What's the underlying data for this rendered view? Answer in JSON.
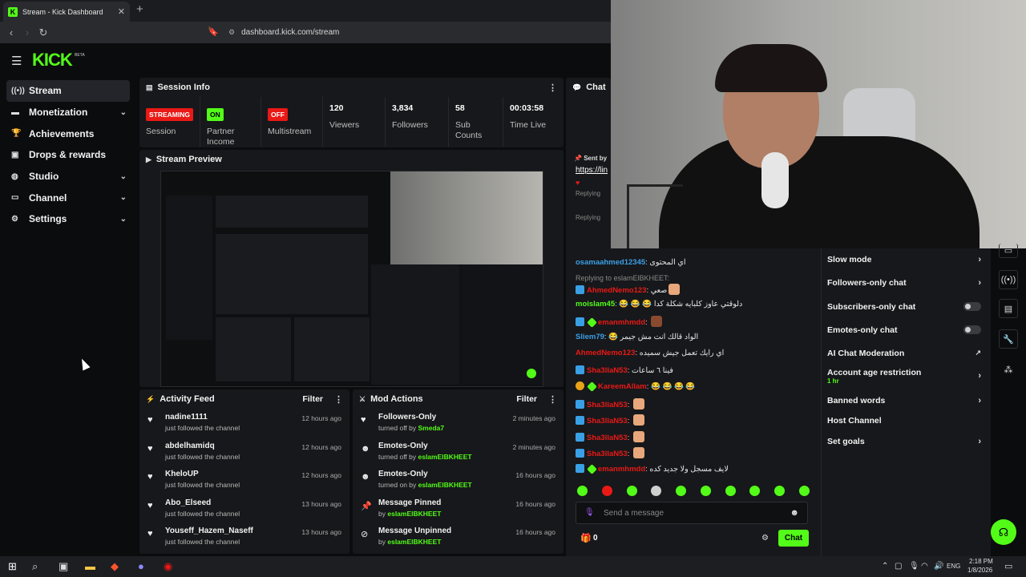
{
  "browser": {
    "tab_title": "Stream - Kick Dashboard",
    "tab_close": "✕",
    "new_tab": "+",
    "url": "dashboard.kick.com/stream"
  },
  "brand": {
    "logo": "KICK",
    "beta": "BETA"
  },
  "sidebar": {
    "items": [
      {
        "label": "Stream",
        "icon": "broadcast-icon"
      },
      {
        "label": "Monetization",
        "icon": "dollar-icon"
      },
      {
        "label": "Achievements",
        "icon": "trophy-icon"
      },
      {
        "label": "Drops & rewards",
        "icon": "gift-icon"
      },
      {
        "label": "Studio",
        "icon": "studio-icon"
      },
      {
        "label": "Channel",
        "icon": "tv-icon"
      },
      {
        "label": "Settings",
        "icon": "gear-icon"
      }
    ]
  },
  "session_info": {
    "title": "Session Info",
    "stats": [
      {
        "badge": "STREAMING",
        "label": "Session"
      },
      {
        "badge": "ON",
        "label": "Partner Income"
      },
      {
        "badge": "OFF",
        "label": "Multistream"
      },
      {
        "value": "120",
        "label": "Viewers"
      },
      {
        "value": "3,834",
        "label": "Followers"
      },
      {
        "value": "58",
        "label": "Sub Counts"
      },
      {
        "value": "00:03:58",
        "label": "Time Live"
      }
    ]
  },
  "stream_preview": {
    "title": "Stream Preview"
  },
  "activity_feed": {
    "title": "Activity Feed",
    "filter": "Filter",
    "items": [
      {
        "name": "nadine1111",
        "sub": "just followed the channel",
        "time": "12 hours ago"
      },
      {
        "name": "abdelhamidq",
        "sub": "just followed the channel",
        "time": "12 hours ago"
      },
      {
        "name": "KheloUP",
        "sub": "just followed the channel",
        "time": "12 hours ago"
      },
      {
        "name": "Abo_Elseed",
        "sub": "just followed the channel",
        "time": "13 hours ago"
      },
      {
        "name": "Youseff_Hazem_Naseff",
        "sub": "just followed the channel",
        "time": "13 hours ago"
      }
    ]
  },
  "mod_actions": {
    "title": "Mod Actions",
    "filter": "Filter",
    "items": [
      {
        "name": "Followers-Only",
        "action": "turned off by",
        "by": "Smeda7",
        "time": "2 minutes ago",
        "icon": "heart-icon"
      },
      {
        "name": "Emotes-Only",
        "action": "turned off by",
        "by": "eslamElBKHEET",
        "time": "2 minutes ago",
        "icon": "smile-icon"
      },
      {
        "name": "Emotes-Only",
        "action": "turned on by",
        "by": "eslamElBKHEET",
        "time": "16 hours ago",
        "icon": "smile-icon"
      },
      {
        "name": "Message Pinned",
        "action": "by",
        "by": "eslamElBKHEET",
        "time": "16 hours ago",
        "icon": "pin-icon"
      },
      {
        "name": "Message Unpinned",
        "action": "by",
        "by": "eslamElBKHEET",
        "time": "16 hours ago",
        "icon": "unpin-icon"
      }
    ]
  },
  "chat": {
    "title": "Chat",
    "sent_by": "Sent by",
    "link_text": "https://lin",
    "replying": "Replying",
    "messages": [
      {
        "user": "osamaahmed12345",
        "color": "#3aa0e6",
        "text": "اي المحتوى"
      },
      {
        "reply": "Replying to eslamElBKHEET:"
      },
      {
        "user": "AhmedNemo123",
        "color": "#e91916",
        "text": "صعي"
      },
      {
        "user": "moislam45",
        "color": "#53fc18",
        "text": "😂 😂 😂 دلوقتي عاوز كلبايه شكلة كدا"
      },
      {
        "user": "emanmhmdd",
        "color": "#e91916",
        "text": ""
      },
      {
        "user": "Sliem79",
        "color": "#3aa0e6",
        "text": "😂 الواد قالك انت مش جيمر"
      },
      {
        "user": "AhmedNemo123",
        "color": "#e91916",
        "text": "اي رايك تعمل جيش سميده"
      },
      {
        "user": "Sha3llaN53",
        "color": "#e91916",
        "text": "فينا ٦ ساعات"
      },
      {
        "user": "KareemAllam",
        "color": "#e91916",
        "text": "😂 😂 😂 😂"
      },
      {
        "user": "Sha3llaN53",
        "color": "#e91916",
        "text": ""
      },
      {
        "user": "Sha3llaN53",
        "color": "#e91916",
        "text": ""
      },
      {
        "user": "Sha3llaN53",
        "color": "#e91916",
        "text": ""
      },
      {
        "user": "Sha3llaN53",
        "color": "#e91916",
        "text": ""
      },
      {
        "user": "emanmhmdd",
        "color": "#e91916",
        "text": "لايف مسجل ولا جديد كده"
      }
    ],
    "input_placeholder": "Send a message",
    "viewer_count": "0",
    "send_label": "Chat"
  },
  "chat_settings": {
    "items": [
      {
        "label": "Slow mode",
        "type": "chevron"
      },
      {
        "label": "Followers-only chat",
        "type": "chevron"
      },
      {
        "label": "Subscribers-only chat",
        "type": "toggle"
      },
      {
        "label": "Emotes-only chat",
        "type": "toggle"
      },
      {
        "label": "AI Chat Moderation",
        "type": "external"
      },
      {
        "label": "Account age restriction",
        "sub": "1 hr",
        "type": "chevron"
      },
      {
        "label": "Banned words",
        "type": "chevron"
      },
      {
        "label": "Host Channel",
        "type": "none"
      },
      {
        "label": "Set goals",
        "type": "chevron"
      }
    ]
  },
  "taskbar": {
    "lang": "ENG",
    "time": "2:18 PM",
    "date": "1/8/2026"
  },
  "colors": {
    "accent": "#53fc18",
    "live_red": "#e91916",
    "panel": "#17181b",
    "bg": "#0b0c0e"
  }
}
